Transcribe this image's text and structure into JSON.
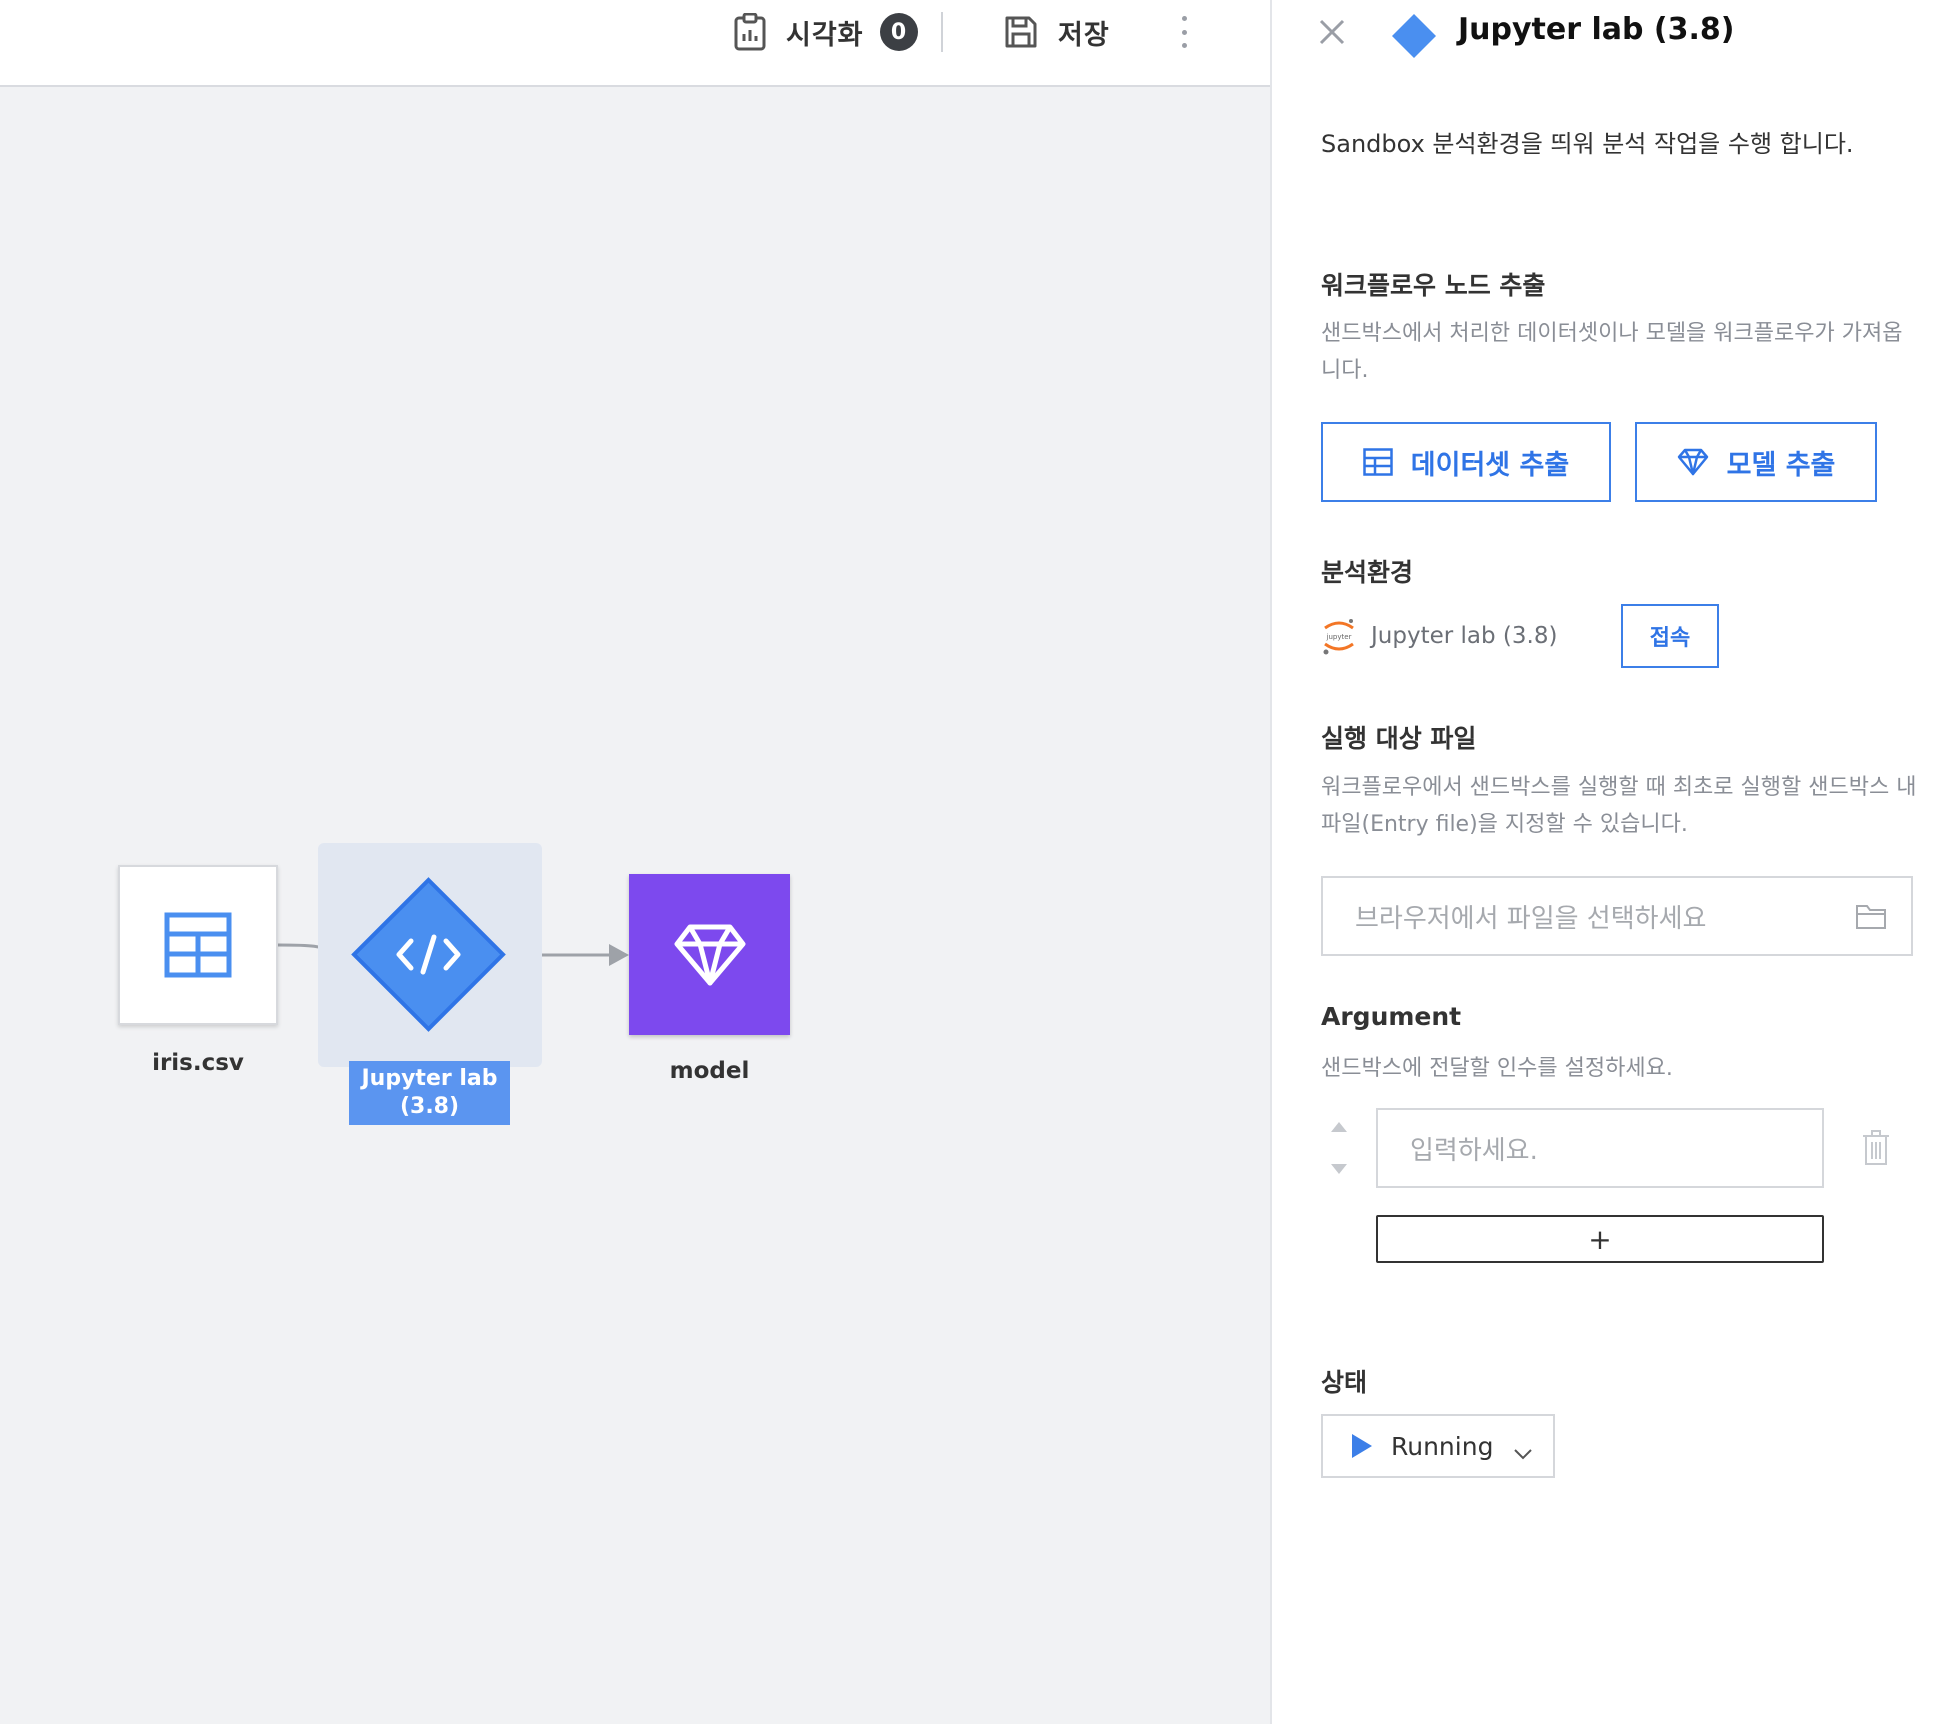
{
  "toolbar": {
    "visualize_label": "시각화",
    "visualize_count": "0",
    "save_label": "저장"
  },
  "canvas": {
    "nodes": [
      {
        "id": "dataset",
        "label": "iris.csv",
        "icon": "table-icon"
      },
      {
        "id": "jupyter",
        "label_line1": "Jupyter lab",
        "label_line2": "(3.8)",
        "icon": "code-icon",
        "selected": true
      },
      {
        "id": "model",
        "label": "model",
        "icon": "diamond-gem-icon"
      }
    ]
  },
  "panel": {
    "title": "Jupyter lab (3.8)",
    "description": "Sandbox 분석환경을 띄워 분석 작업을 수행 합니다.",
    "extract": {
      "title": "워크플로우 노드 추출",
      "text": "샌드박스에서 처리한 데이터셋이나 모델을 워크플로우가 가져옵니다.",
      "dataset_button": "데이터셋 추출",
      "model_button": "모델 추출"
    },
    "env": {
      "title": "분석환경",
      "name": "Jupyter lab (3.8)",
      "connect_button": "접속"
    },
    "entry": {
      "title": "실행 대상 파일",
      "text": "워크플로우에서 샌드박스를 실행할 때 최초로 실행할 샌드박스 내 파일(Entry file)을 지정할 수 있습니다.",
      "placeholder": "브라우저에서 파일을 선택하세요"
    },
    "argument": {
      "title": "Argument",
      "text": "샌드박스에 전달할 인수를 설정하세요.",
      "placeholder": "입력하세요.",
      "add_label": "+"
    },
    "status": {
      "title": "상태",
      "value": "Running"
    }
  },
  "colors": {
    "accent": "#3c7fe8",
    "node_jupyter": "#4a8ff0",
    "node_model": "#7d49ee",
    "selection_label": "#5b95f0"
  }
}
